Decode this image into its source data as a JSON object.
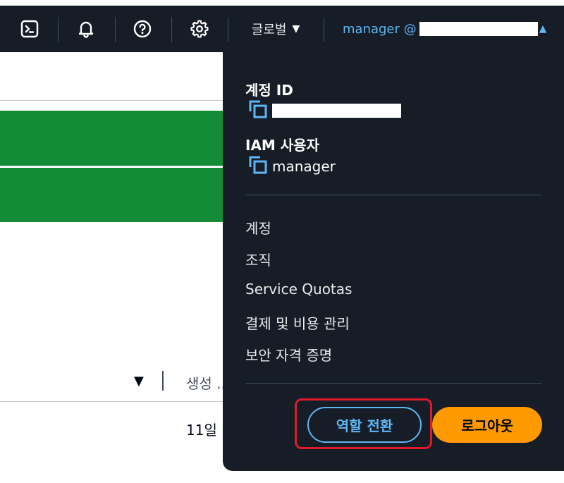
{
  "topbar": {
    "icons": [
      "cloudshell-icon",
      "bell-icon",
      "help-icon",
      "gear-icon"
    ],
    "region_label": "글로벌",
    "user_label": "manager @"
  },
  "background": {
    "column_header": "생성 ...",
    "row_value": "11일"
  },
  "account_menu": {
    "account_id_label": "계정 ID",
    "iam_user_label": "IAM 사용자",
    "iam_user_value": "manager",
    "items": [
      "계정",
      "조직",
      "Service Quotas",
      "결제 및 비용 관리",
      "보안 자격 증명"
    ],
    "switch_role_label": "역할 전환",
    "logout_label": "로그아웃"
  },
  "colors": {
    "nav_bg": "#161d26",
    "link_blue": "#5fb6f5",
    "success_green": "#138a36",
    "logout_orange": "#ff9900",
    "highlight_red": "#e0192c"
  }
}
